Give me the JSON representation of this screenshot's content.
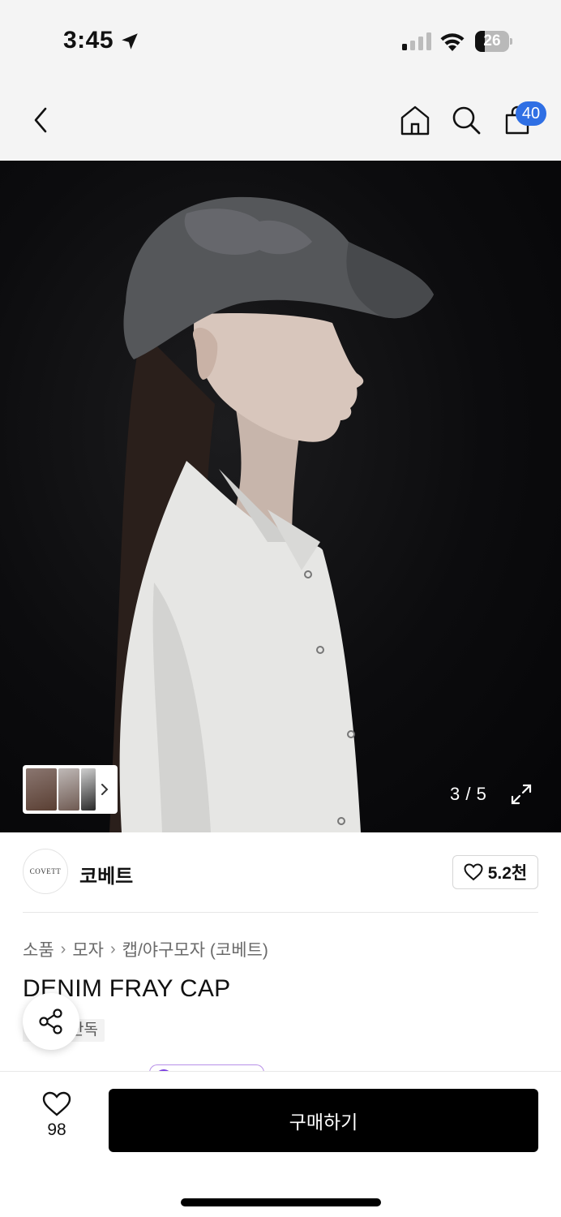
{
  "status_bar": {
    "time": "3:45",
    "battery": "26"
  },
  "nav": {
    "cart_count": "40"
  },
  "gallery": {
    "counter": "3 / 5"
  },
  "brand": {
    "logo_text": "COVETT",
    "name": "코베트",
    "likes": "5.2천"
  },
  "breadcrumb": [
    "소품",
    "모자",
    "캡/야구모자 (코베트)"
  ],
  "product": {
    "title": "DENIM FRAY CAP",
    "tag": "단독"
  },
  "bottom": {
    "wishlist_count": "98",
    "buy_label": "구매하기"
  },
  "colors": {
    "accent": "#2f6fe4",
    "buy_button": "#000000",
    "promo": "#7a3ee0"
  },
  "icons": [
    "location-arrow-icon",
    "cellular-signal-icon",
    "wifi-icon",
    "battery-icon",
    "back-chevron-icon",
    "home-icon",
    "search-icon",
    "shopping-bag-icon",
    "chevron-right-icon",
    "expand-icon",
    "heart-icon",
    "share-icon"
  ]
}
